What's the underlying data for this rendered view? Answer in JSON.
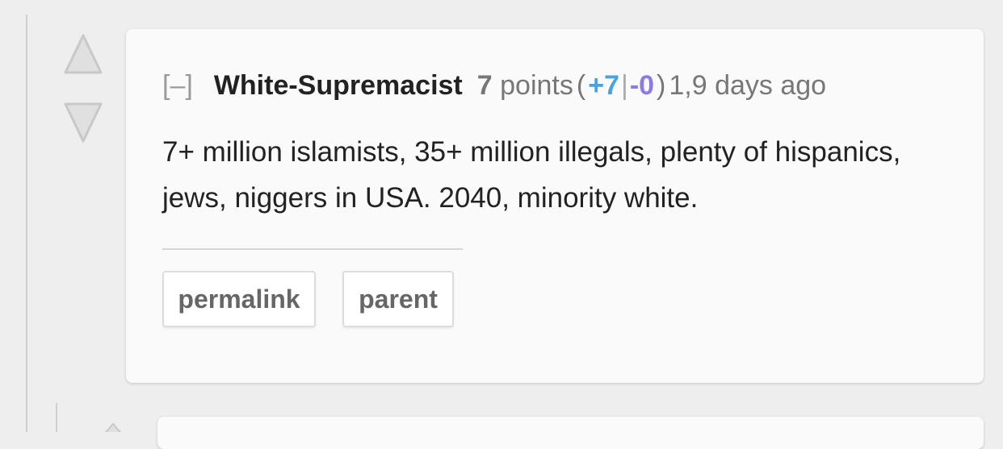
{
  "comment": {
    "collapse_label": "[–]",
    "author": "White-Supremacist",
    "score": "7",
    "score_label": "points",
    "open_paren": "(",
    "upvotes": "+7",
    "separator": "|",
    "downvotes": "-0",
    "close_paren": ")",
    "age": "1,9 days ago",
    "body": "7+ million islamists, 35+ million illegals, plenty of hispanics, jews, niggers in USA. 2040, minority white.",
    "actions": {
      "permalink": "permalink",
      "parent": "parent"
    }
  },
  "icons": {
    "upvote": "upvote-arrow-icon",
    "downvote": "downvote-arrow-icon"
  },
  "colors": {
    "upvotes": "#4aa3df",
    "downvotes": "#8c7ae6",
    "author": "#222222",
    "meta": "#777777"
  }
}
